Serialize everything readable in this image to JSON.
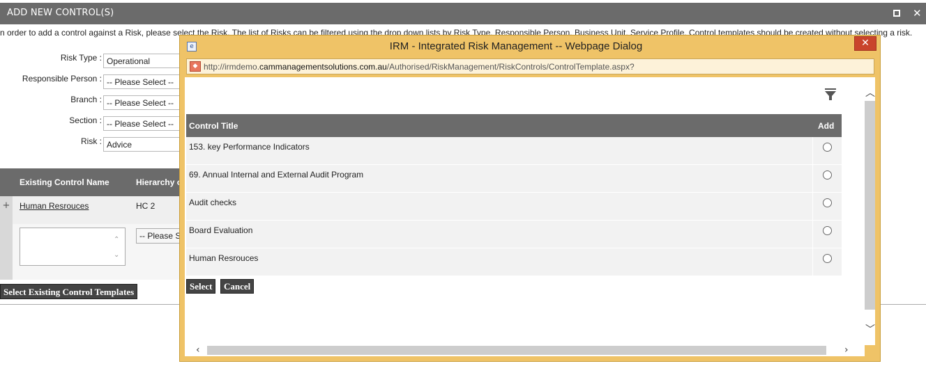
{
  "window": {
    "title": "ADD NEW CONTROL(S)",
    "maximize_icon": "maximize-icon",
    "close_label": "✕"
  },
  "instructions": "n order to add a control against a Risk, please select the Risk. The list of Risks can be filtered using the drop down lists by Risk Type, Responsible Person, Business Unit, Service Profile. Control templates should be created without selecting a risk.",
  "filters": [
    {
      "label": "Risk Type :",
      "value": "Operational"
    },
    {
      "label": "Responsible Person :",
      "value": "-- Please Select --"
    },
    {
      "label": "Branch :",
      "value": "-- Please Select --"
    },
    {
      "label": "Section :",
      "value": "-- Please Select --"
    },
    {
      "label": "Risk :",
      "value": "Advice"
    }
  ],
  "existing_grid": {
    "headers": [
      "Existing Control Name",
      "Hierarchy of"
    ],
    "rows": [
      {
        "expand": "+",
        "name": "Human Resrouces",
        "hierarchy": "HC 2"
      }
    ],
    "edit_select_placeholder": "-- Please Select --",
    "select_existing_label": "Select Existing Control Templates"
  },
  "dialog": {
    "title": "IRM - Integrated Risk Management -- Webpage Dialog",
    "close_label": "✕",
    "url_prefix": "http://irmdemo.",
    "url_domain": "cammanagementsolutions.com.au",
    "url_path": "/Authorised/RiskManagement/RiskControls/ControlTemplate.aspx?",
    "table": {
      "headers": {
        "title": "Control Title",
        "add": "Add"
      },
      "rows": [
        {
          "title": "153. key Performance Indicators"
        },
        {
          "title": "69. Annual Internal and External Audit Program"
        },
        {
          "title": "Audit checks"
        },
        {
          "title": "Board Evaluation"
        },
        {
          "title": "Human Resrouces"
        }
      ]
    },
    "select_label": "Select",
    "cancel_label": "Cancel"
  },
  "colors": {
    "header_gray": "#6b6b6b",
    "dialog_frame": "#efc367",
    "close_red": "#c9442c",
    "button_dark": "#444444"
  }
}
